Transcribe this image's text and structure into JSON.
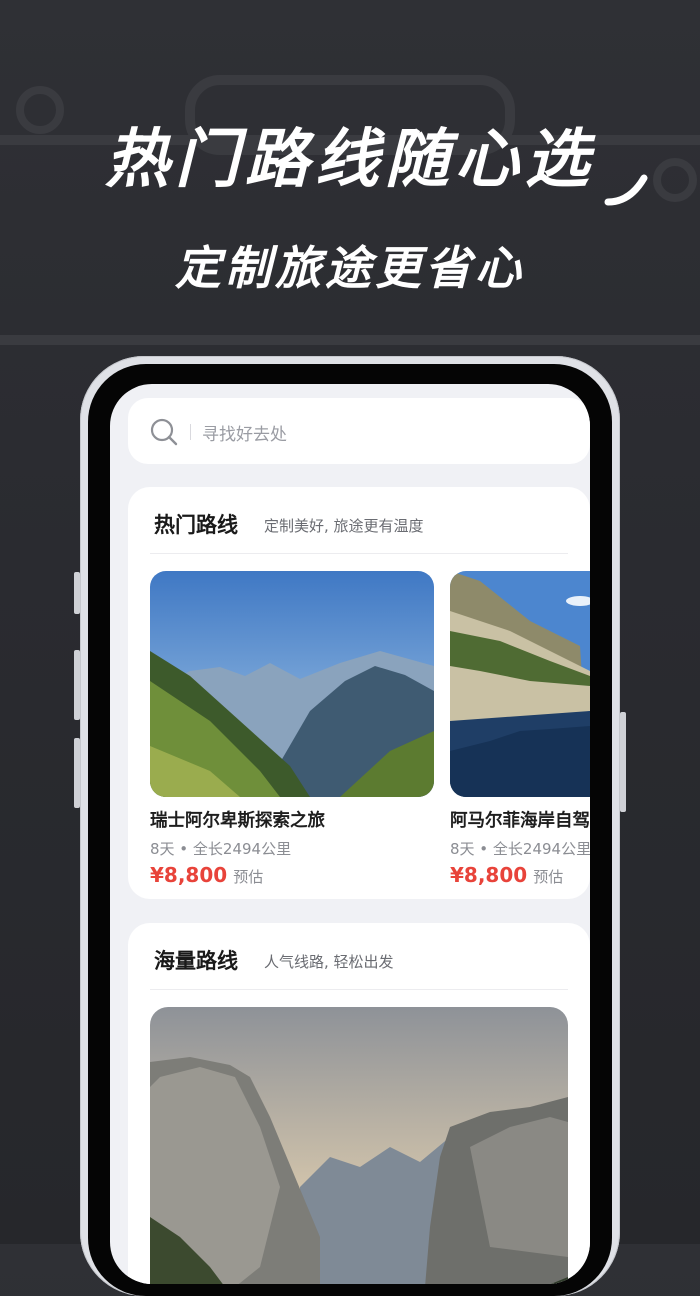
{
  "promo": {
    "headline": "热门路线随心选",
    "subheadline": "定制旅途更省心"
  },
  "search": {
    "placeholder": "寻找好去处"
  },
  "hot_routes": {
    "title": "热门路线",
    "subtitle": "定制美好, 旅途更有温度",
    "items": [
      {
        "name": "瑞士阿尔卑斯探索之旅",
        "meta": "8天 • 全长2494公里",
        "price": "¥8,800",
        "price_note": "预估"
      },
      {
        "name": "阿马尔菲海岸自驾",
        "meta": "8天 • 全长2494公里",
        "price": "¥8,800",
        "price_note": "预估"
      }
    ]
  },
  "mass_routes": {
    "title": "海量路线",
    "subtitle": "人气线路, 轻松出发"
  },
  "colors": {
    "background": "#2a2b30",
    "accent_price": "#e8433a",
    "screen_bg": "#f0f1f5"
  }
}
